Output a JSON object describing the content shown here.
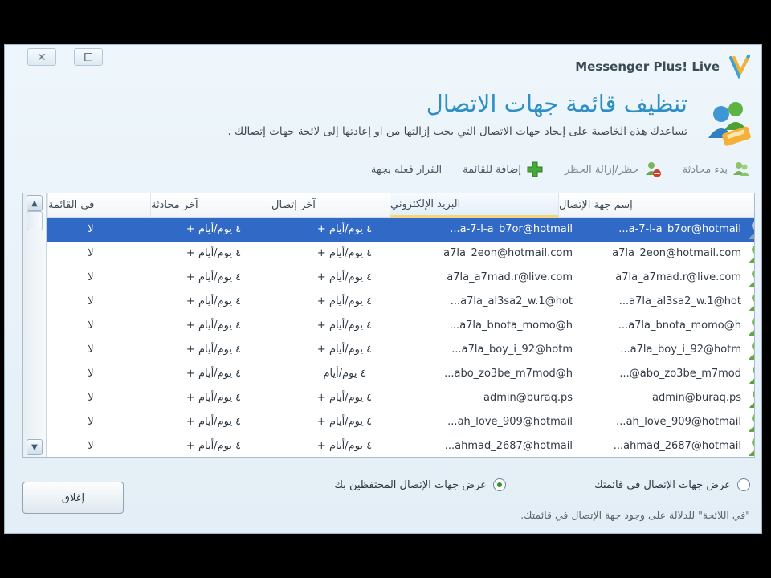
{
  "window": {
    "app_title": "Messenger Plus! Live",
    "close_glyph": "✕",
    "restore_glyph": "⧠"
  },
  "header": {
    "title": "تنظيف قائمة جهات الاتصال",
    "description": "تساعدك هذه الخاصية على إيجاد جهات الاتصال التي يجب إزالتها من او إعادتها إلى لائحة جهات إتصالك ."
  },
  "toolbar": {
    "items": [
      {
        "label": "القرار فعله بجهة",
        "icon": "user-action-icon"
      },
      {
        "label": "إضافة للقائمة",
        "icon": "add-green-icon"
      },
      {
        "label": "حظر/إزالة الحظر",
        "icon": "block-user-icon"
      },
      {
        "label": "بدء محادثة",
        "icon": "chat-icon"
      }
    ]
  },
  "table": {
    "columns": [
      "إسم جهة الإتصال",
      "البريد الإلكتروني",
      "آخر إتصال",
      "آخر محادثة",
      "في القائمة"
    ],
    "rows": [
      {
        "name": "...a-7-ا-a_b7or@hotmail",
        "email": "...a-7-ا-a_b7or@hotmail",
        "last_contact": "٤ يوم/أيام +",
        "last_chat": "٤ يوم/أيام +",
        "in_list": "لا",
        "selected": true,
        "icon": "contact-selected-icon"
      },
      {
        "name": "a7la_2eon@hotmail.com",
        "email": "a7la_2eon@hotmail.com",
        "last_contact": "٤ يوم/أيام +",
        "last_chat": "٤ يوم/أيام +",
        "in_list": "لا",
        "selected": false,
        "icon": "contact-blocked-icon"
      },
      {
        "name": "a7la_a7mad.r@live.com",
        "email": "a7la_a7mad.r@live.com",
        "last_contact": "٤ يوم/أيام +",
        "last_chat": "٤ يوم/أيام +",
        "in_list": "لا",
        "selected": false,
        "icon": "contact-blocked-icon"
      },
      {
        "name": "...a7la_al3sa2_w.1@hot",
        "email": "...a7la_al3sa2_w.1@hot",
        "last_contact": "٤ يوم/أيام +",
        "last_chat": "٤ يوم/أيام +",
        "in_list": "لا",
        "selected": false,
        "icon": "contact-blocked-icon"
      },
      {
        "name": "...a7la_bnota_momo@h",
        "email": "...a7la_bnota_momo@h",
        "last_contact": "٤ يوم/أيام +",
        "last_chat": "٤ يوم/أيام +",
        "in_list": "لا",
        "selected": false,
        "icon": "contact-blocked-icon"
      },
      {
        "name": "...a7la_boy_i_92@hotm",
        "email": "...a7la_boy_i_92@hotm",
        "last_contact": "٤ يوم/أيام +",
        "last_chat": "٤ يوم/أيام +",
        "in_list": "لا",
        "selected": false,
        "icon": "contact-blocked-icon"
      },
      {
        "name": "...@abo_zo3be_m7mod",
        "email": "...abo_zo3be_m7mod@h",
        "last_contact": "٤ يوم/أيام",
        "last_chat": "٤ يوم/أيام +",
        "in_list": "لا",
        "selected": false,
        "icon": "contact-icon"
      },
      {
        "name": "admin@buraq.ps",
        "email": "admin@buraq.ps",
        "last_contact": "٤ يوم/أيام +",
        "last_chat": "٤ يوم/أيام +",
        "in_list": "لا",
        "selected": false,
        "icon": "contact-icon"
      },
      {
        "name": "...ah_love_909@hotmail",
        "email": "...ah_love_909@hotmail",
        "last_contact": "٤ يوم/أيام +",
        "last_chat": "٤ يوم/أيام +",
        "in_list": "لا",
        "selected": false,
        "icon": "contact-blocked-icon"
      },
      {
        "name": "...ahmad_2687@hotmail",
        "email": "...ahmad_2687@hotmail",
        "last_contact": "٤ يوم/أيام +",
        "last_chat": "٤ يوم/أيام +",
        "in_list": "لا",
        "selected": false,
        "icon": "contact-blocked-icon"
      }
    ]
  },
  "scrollbar": {
    "up_glyph": "▲",
    "down_glyph": "▼"
  },
  "options": {
    "show_in_list_label": "عرض جهات الإتصال في قائمتك",
    "show_in_list_checked": false,
    "show_keeping_you_label": "عرض جهات الإتصال المحتفظين بك",
    "show_keeping_you_checked": true
  },
  "footnote": "\"في اللائحة\" للدلالة على وجود جهة الإتصال في قائمتك.",
  "close_button": "إغلاق",
  "colors": {
    "accent_title": "#2d8fc5",
    "selection": "#3169c6",
    "sorted_column": "#f5d67a"
  }
}
